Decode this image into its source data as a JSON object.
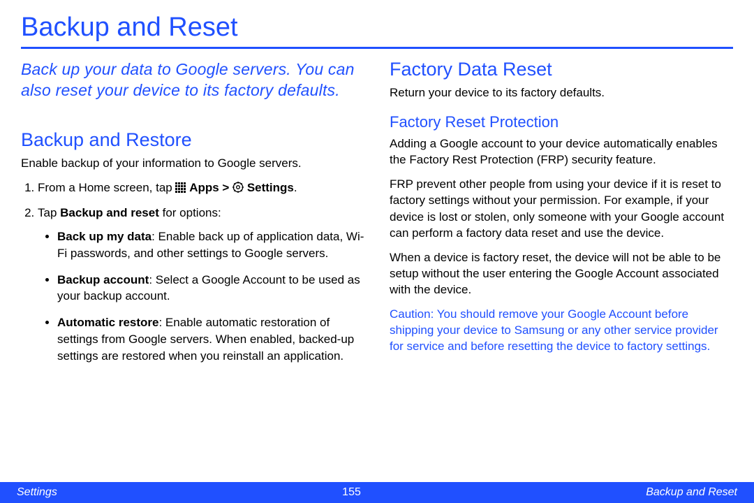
{
  "page_title": "Backup and Reset",
  "lead": "Back up your data to Google servers. You can also reset your device to its factory defaults.",
  "left": {
    "h2": "Backup and Restore",
    "intro": "Enable backup of your information to Google servers.",
    "step1_prefix": "From a Home screen, tap ",
    "step1_apps": "Apps",
    "step1_sep": " > ",
    "step1_settings": "Settings",
    "step1_suffix": ".",
    "step2_prefix": "Tap ",
    "step2_bold": "Backup and reset",
    "step2_suffix": " for options:",
    "bullet1_title": "Back up my data",
    "bullet1_body": ": Enable back up of application data, Wi-Fi passwords, and other settings to Google servers.",
    "bullet2_title": "Backup account",
    "bullet2_body": ": Select a Google Account to be used as your backup account.",
    "bullet3_title": "Automatic restore",
    "bullet3_body": ": Enable automatic restoration of settings from Google servers. When enabled, backed-up settings are restored when you reinstall an application."
  },
  "right": {
    "h2": "Factory Data Reset",
    "intro": "Return your device to its factory defaults.",
    "h3": "Factory Reset Protection",
    "p1": "Adding a Google account to your device automatically enables the Factory Rest Protection (FRP) security feature.",
    "p2": "FRP prevent other people from using your device if it is reset to factory settings without your permission. For example, if your device is lost or stolen, only someone with your Google account can perform a factory data reset and use the device.",
    "p3": "When a device is factory reset, the device will not be able to be setup without the user entering the Google Account associated with the device.",
    "caution_label": "Caution",
    "caution_body": ": You should remove your Google Account before shipping your device to Samsung or any other service provider for service and before resetting the device to factory settings."
  },
  "footer": {
    "left": "Settings",
    "page": "155",
    "right": "Backup and Reset"
  }
}
